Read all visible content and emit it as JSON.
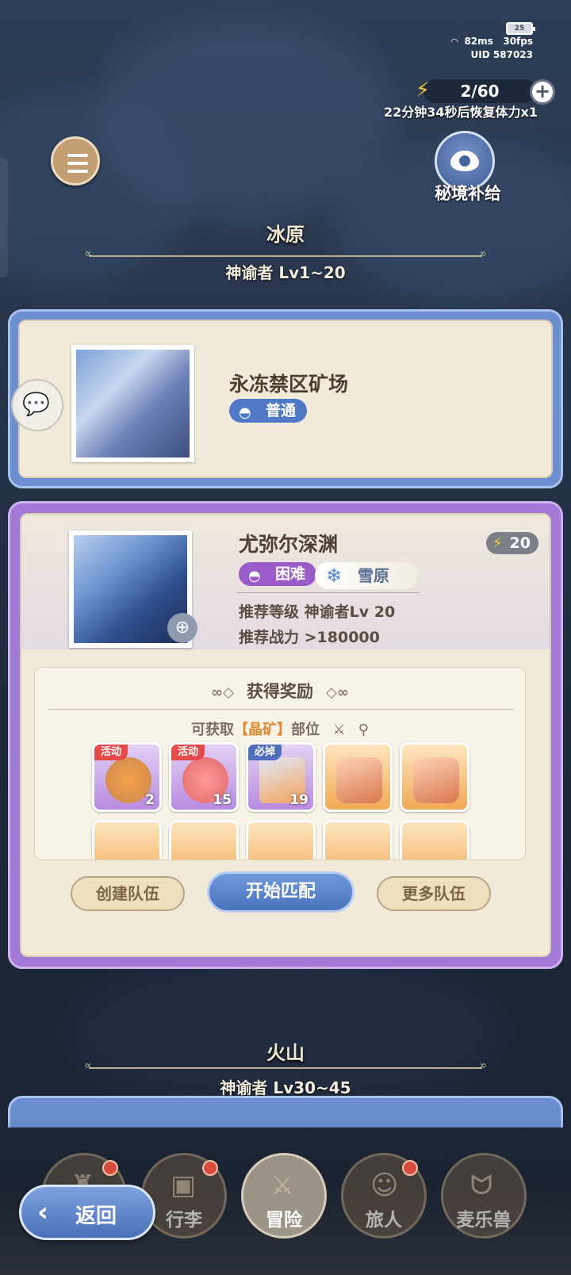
{
  "status": {
    "battery": "25",
    "ping": "82ms",
    "fps": "30fps",
    "uid": "UID 587023"
  },
  "stamina": {
    "value": "2/60",
    "recover": "22分钟34秒后恢复体力x1",
    "add_icon": "plus-icon",
    "icon": "lightning-icon"
  },
  "secret_supply": {
    "label": "秘境补给",
    "icon": "eye-icon"
  },
  "region1": {
    "name": "冰原",
    "level": "神谕者 Lv1~20"
  },
  "dungeon1": {
    "name": "永冻禁区矿场",
    "difficulty": "普通"
  },
  "dungeon2": {
    "name": "尤弥尔深渊",
    "difficulty": "困难",
    "element": "雪原",
    "cost": "20",
    "rec_level": "推荐等级 神谕者Lv 20",
    "rec_power": "推荐战力 >180000"
  },
  "rewards": {
    "title": "获得奖励",
    "sub_prefix": "可获取",
    "sub_highlight": "【晶矿】",
    "sub_suffix": "部位",
    "items": [
      {
        "tag": "活动",
        "count": "2"
      },
      {
        "tag": "活动",
        "count": "15"
      },
      {
        "tag": "必掉",
        "count": "19"
      },
      {
        "tag": "",
        "count": ""
      },
      {
        "tag": "",
        "count": ""
      }
    ]
  },
  "buttons": {
    "create": "创建队伍",
    "start": "开始匹配",
    "more": "更多队伍"
  },
  "region2": {
    "name": "火山",
    "level": "神谕者 Lv30~45"
  },
  "nav": {
    "back": "返回",
    "items": [
      "行李",
      "冒险",
      "旅人",
      "麦乐兽"
    ]
  }
}
